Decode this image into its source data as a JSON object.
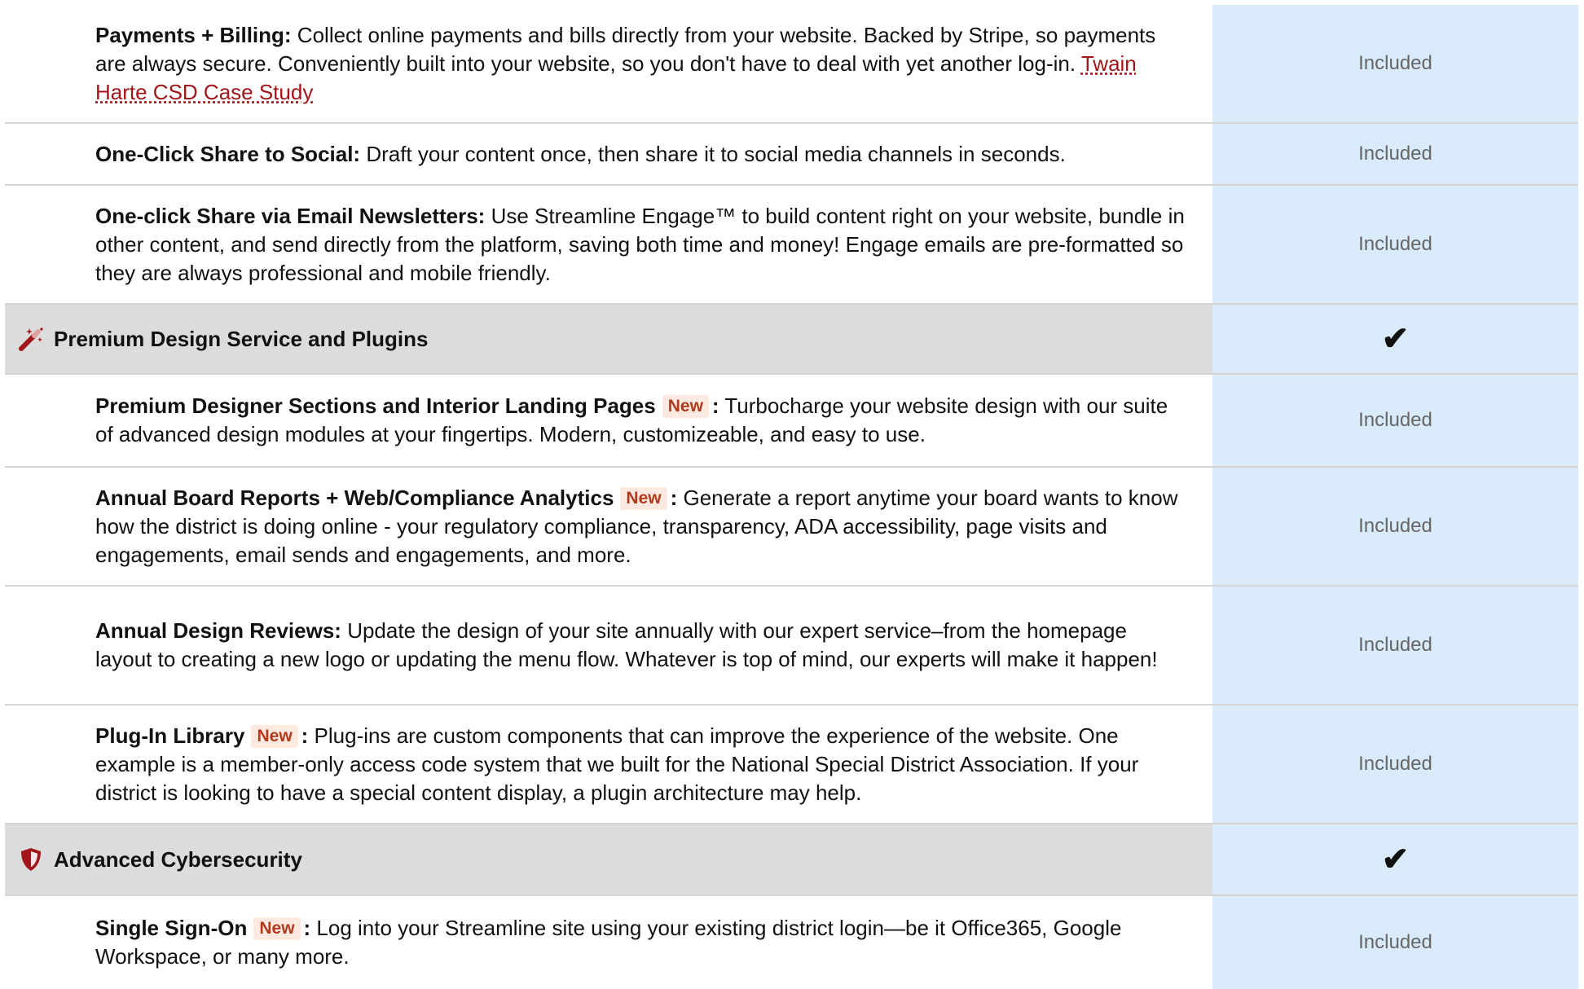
{
  "rows": [
    {
      "kind": "feature",
      "title": "Payments + Billing:",
      "text": " Collect online payments and bills directly from your website. Backed by Stripe, so payments are always secure. Conveniently built into your website, so you don't have to deal with yet another log-in. ",
      "link": "Twain Harte CSD Case Study",
      "status": "Included"
    },
    {
      "kind": "feature",
      "title": "One-Click Share to Social:",
      "text": " Draft your content once, then share it to social media channels in seconds.",
      "status": "Included"
    },
    {
      "kind": "feature",
      "title": "One-click Share via Email Newsletters:",
      "text": " Use Streamline Engage™ to build content right on your website, bundle in other content, and send directly from the platform, saving both time and money! Engage emails are pre-formatted so they are always professional and mobile friendly.",
      "status": "Included"
    },
    {
      "kind": "section",
      "icon": "magic-wand-icon",
      "title": "Premium Design Service and Plugins",
      "status": "✔"
    },
    {
      "kind": "feature",
      "title": "Premium Designer Sections and Interior Landing Pages",
      "badge": "New",
      "colon": ":",
      "text": " Turbocharge your website design with our suite of advanced design modules at your fingertips. Modern, customizeable, and easy to use.",
      "status": "Included"
    },
    {
      "kind": "feature",
      "title": "Annual Board Reports + Web/Compliance Analytics",
      "badge": "New",
      "colon": ":",
      "text": " Generate a report anytime your board wants to know how the district is doing online - your regulatory compliance, transparency, ADA accessibility, page visits and engagements, email sends and engagements, and more.",
      "status": "Included"
    },
    {
      "kind": "feature",
      "title": "Annual Design Reviews:",
      "text": " Update the design of your site annually with our expert service–from the homepage layout to creating a new logo or updating the menu flow. Whatever is top of mind, our experts will make it happen!",
      "status": "Included"
    },
    {
      "kind": "feature",
      "title": "Plug-In Library",
      "badge": "New",
      "colon": ":",
      "text": " Plug-ins are custom components that can improve the experience of the website. One example is a member-only access code system that we built for the National Special District Association. If your district is looking to have a special content display, a plugin architecture may help.",
      "status": "Included"
    },
    {
      "kind": "section",
      "icon": "shield-icon",
      "title": "Advanced Cybersecurity",
      "status": "✔"
    },
    {
      "kind": "feature",
      "title": "Single Sign-On",
      "badge": "New",
      "colon": ":",
      "text": " Log into your Streamline site using your existing district login—be it Office365, Google Workspace, or many more.",
      "status": "Included"
    }
  ],
  "colors": {
    "included_column_bg": "#d9eafa",
    "section_bg": "#dcdcdc",
    "badge_bg": "#fde9e0",
    "badge_text": "#b03a1e",
    "icon_red": "#a1161a",
    "link": "#a1161a"
  }
}
